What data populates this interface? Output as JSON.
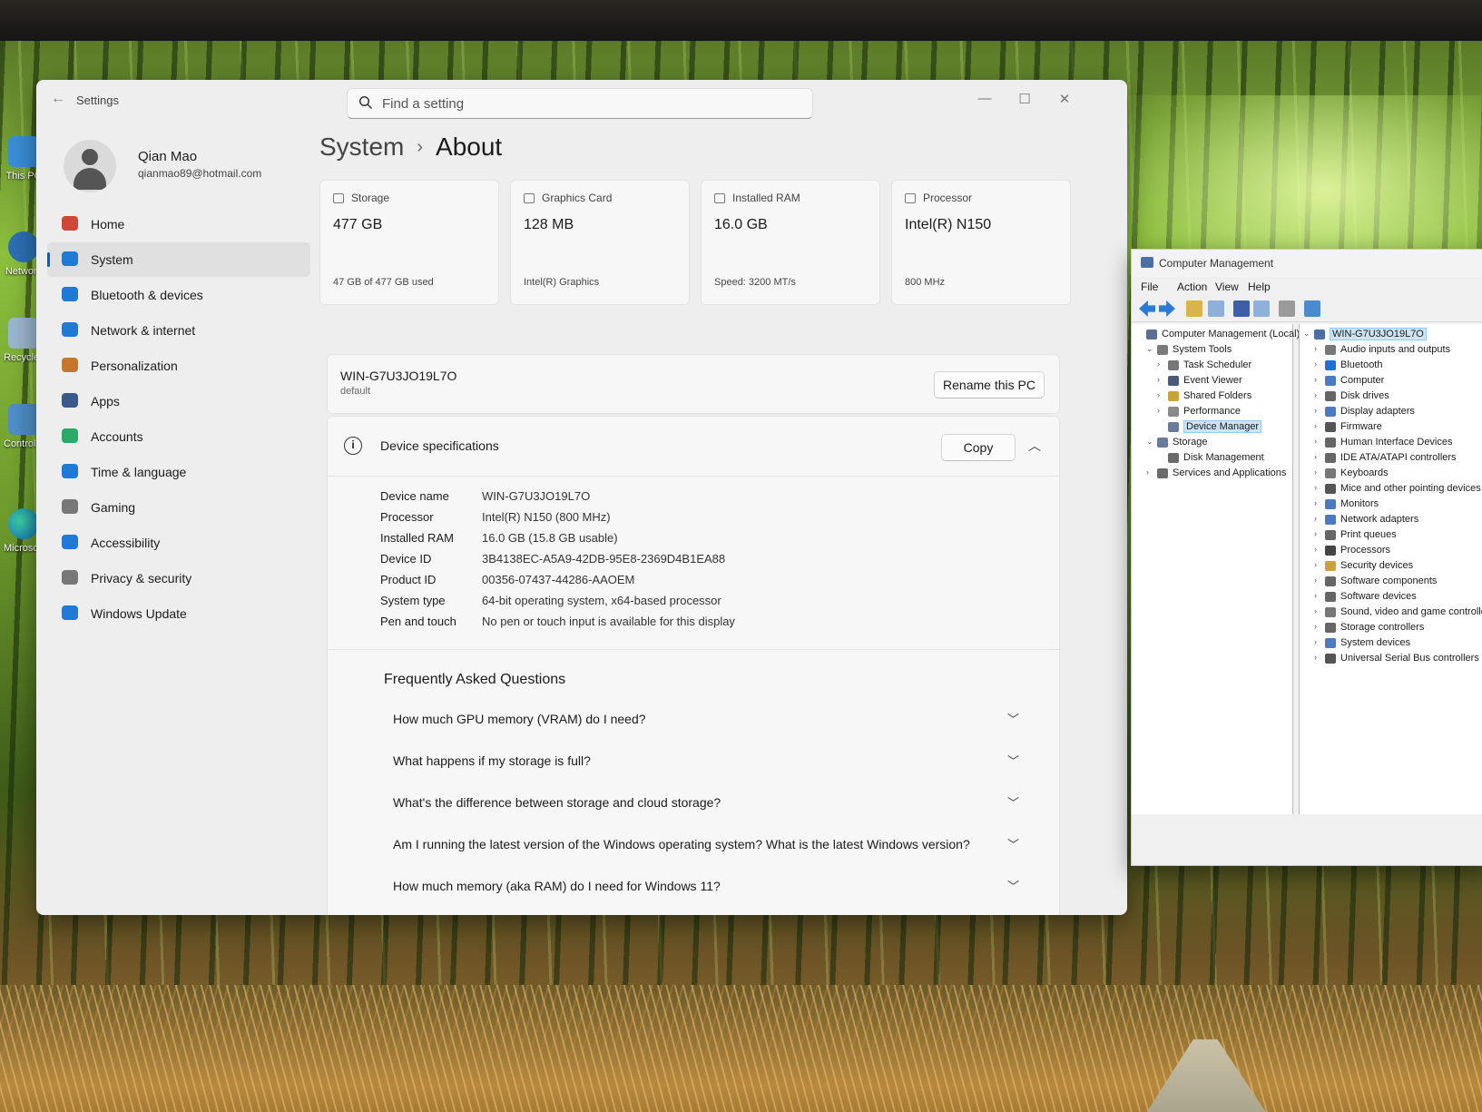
{
  "settings": {
    "window_title": "Settings",
    "search_placeholder": "Find a setting",
    "controls": {
      "minimize": "—",
      "maximize": "☐",
      "close": "✕"
    },
    "user": {
      "name": "Qian Mao",
      "email": "qianmao89@hotmail.com"
    },
    "nav": [
      {
        "label": "Home",
        "icon": "home-icon",
        "color": "#d0473a"
      },
      {
        "label": "System",
        "icon": "system-icon",
        "color": "#1f7ad6",
        "active": true
      },
      {
        "label": "Bluetooth & devices",
        "icon": "bluetooth-icon",
        "color": "#1f7ad6"
      },
      {
        "label": "Network & internet",
        "icon": "wifi-icon",
        "color": "#1f7ad6"
      },
      {
        "label": "Personalization",
        "icon": "brush-icon",
        "color": "#c5762a"
      },
      {
        "label": "Apps",
        "icon": "apps-icon",
        "color": "#3a5a8c"
      },
      {
        "label": "Accounts",
        "icon": "accounts-icon",
        "color": "#2ea866"
      },
      {
        "label": "Time & language",
        "icon": "globe-clock-icon",
        "color": "#1f7ad6"
      },
      {
        "label": "Gaming",
        "icon": "gamepad-icon",
        "color": "#777777"
      },
      {
        "label": "Accessibility",
        "icon": "accessibility-icon",
        "color": "#1f7ad6"
      },
      {
        "label": "Privacy & security",
        "icon": "shield-icon",
        "color": "#777777"
      },
      {
        "label": "Windows Update",
        "icon": "update-icon",
        "color": "#1f7ad6"
      }
    ],
    "breadcrumb": {
      "parent": "System",
      "separator": "›",
      "current": "About"
    },
    "cards": [
      {
        "title": "Storage",
        "value": "477 GB",
        "sub": "47 GB of 477 GB used"
      },
      {
        "title": "Graphics Card",
        "value": "128 MB",
        "sub": "Intel(R) Graphics"
      },
      {
        "title": "Installed RAM",
        "value": "16.0 GB",
        "sub": "Speed: 3200 MT/s"
      },
      {
        "title": "Processor",
        "value": "Intel(R) N150",
        "sub": "800 MHz"
      }
    ],
    "pc": {
      "name": "WIN-G7U3JO19L7O",
      "sub": "default",
      "rename_label": "Rename this PC"
    },
    "device_specs": {
      "title": "Device specifications",
      "copy_label": "Copy",
      "rows": [
        {
          "k": "Device name",
          "v": "WIN-G7U3JO19L7O"
        },
        {
          "k": "Processor",
          "v": "Intel(R) N150 (800 MHz)"
        },
        {
          "k": "Installed RAM",
          "v": "16.0 GB (15.8 GB usable)"
        },
        {
          "k": "Device ID",
          "v": "3B4138EC-A5A9-42DB-95E8-2369D4B1EA88"
        },
        {
          "k": "Product ID",
          "v": "00356-07437-44286-AAOEM"
        },
        {
          "k": "System type",
          "v": "64-bit operating system, x64-based processor"
        },
        {
          "k": "Pen and touch",
          "v": "No pen or touch input is available for this display"
        }
      ]
    },
    "faq": {
      "title": "Frequently Asked Questions",
      "items": [
        "How much GPU memory (VRAM) do I need?",
        "What happens if my storage is full?",
        "What's the difference between storage and cloud storage?",
        "Am I running the latest version of the Windows operating system? What is the latest Windows version?",
        "How much memory (aka RAM) do I need for Windows 11?"
      ]
    }
  },
  "computer_management": {
    "title": "Computer Management",
    "menu": [
      "File",
      "Action",
      "View",
      "Help"
    ],
    "left_tree": [
      {
        "label": "Computer Management (Local)",
        "depth": 0,
        "twisty": "",
        "icon_color": "#5b6f8c"
      },
      {
        "label": "System Tools",
        "depth": 1,
        "twisty": "⌄",
        "icon_color": "#7a7a7a"
      },
      {
        "label": "Task Scheduler",
        "depth": 2,
        "twisty": "›",
        "icon_color": "#777777"
      },
      {
        "label": "Event Viewer",
        "depth": 2,
        "twisty": "›",
        "icon_color": "#4a5a7a"
      },
      {
        "label": "Shared Folders",
        "depth": 2,
        "twisty": "›",
        "icon_color": "#c9a23a"
      },
      {
        "label": "Performance",
        "depth": 2,
        "twisty": "›",
        "icon_color": "#8a8a8a"
      },
      {
        "label": "Device Manager",
        "depth": 2,
        "twisty": "",
        "icon_color": "#6a7a9a",
        "selected": true
      },
      {
        "label": "Storage",
        "depth": 1,
        "twisty": "⌄",
        "icon_color": "#6a7a9a"
      },
      {
        "label": "Disk Management",
        "depth": 2,
        "twisty": "",
        "icon_color": "#6a6a6a"
      },
      {
        "label": "Services and Applications",
        "depth": 1,
        "twisty": "›",
        "icon_color": "#6a6a6a"
      }
    ],
    "right_tree": [
      {
        "label": "WIN-G7U3JO19L7O",
        "depth": 0,
        "twisty": "⌄",
        "icon_color": "#4a6fa5",
        "selected": true
      },
      {
        "label": "Audio inputs and outputs",
        "depth": 1,
        "twisty": "›",
        "icon_color": "#777777"
      },
      {
        "label": "Bluetooth",
        "depth": 1,
        "twisty": "›",
        "icon_color": "#1f6fd6"
      },
      {
        "label": "Computer",
        "depth": 1,
        "twisty": "›",
        "icon_color": "#4a7ac0"
      },
      {
        "label": "Disk drives",
        "depth": 1,
        "twisty": "›",
        "icon_color": "#666666"
      },
      {
        "label": "Display adapters",
        "depth": 1,
        "twisty": "›",
        "icon_color": "#4a7ac0"
      },
      {
        "label": "Firmware",
        "depth": 1,
        "twisty": "›",
        "icon_color": "#555555"
      },
      {
        "label": "Human Interface Devices",
        "depth": 1,
        "twisty": "›",
        "icon_color": "#666666"
      },
      {
        "label": "IDE ATA/ATAPI controllers",
        "depth": 1,
        "twisty": "›",
        "icon_color": "#666666"
      },
      {
        "label": "Keyboards",
        "depth": 1,
        "twisty": "›",
        "icon_color": "#777777"
      },
      {
        "label": "Mice and other pointing devices",
        "depth": 1,
        "twisty": "›",
        "icon_color": "#555555"
      },
      {
        "label": "Monitors",
        "depth": 1,
        "twisty": "›",
        "icon_color": "#4a7ac0"
      },
      {
        "label": "Network adapters",
        "depth": 1,
        "twisty": "›",
        "icon_color": "#4a7ac0"
      },
      {
        "label": "Print queues",
        "depth": 1,
        "twisty": "›",
        "icon_color": "#666666"
      },
      {
        "label": "Processors",
        "depth": 1,
        "twisty": "›",
        "icon_color": "#444444"
      },
      {
        "label": "Security devices",
        "depth": 1,
        "twisty": "›",
        "icon_color": "#c9a23a"
      },
      {
        "label": "Software components",
        "depth": 1,
        "twisty": "›",
        "icon_color": "#666666"
      },
      {
        "label": "Software devices",
        "depth": 1,
        "twisty": "›",
        "icon_color": "#666666"
      },
      {
        "label": "Sound, video and game controllers",
        "depth": 1,
        "twisty": "›",
        "icon_color": "#777777"
      },
      {
        "label": "Storage controllers",
        "depth": 1,
        "twisty": "›",
        "icon_color": "#666666"
      },
      {
        "label": "System devices",
        "depth": 1,
        "twisty": "›",
        "icon_color": "#4a7ac0"
      },
      {
        "label": "Universal Serial Bus controllers",
        "depth": 1,
        "twisty": "›",
        "icon_color": "#555555"
      }
    ]
  },
  "desktop": {
    "icons": [
      "This PC",
      "Network",
      "Recycle Bin",
      "Control Panel",
      "Microsoft Edge"
    ]
  }
}
